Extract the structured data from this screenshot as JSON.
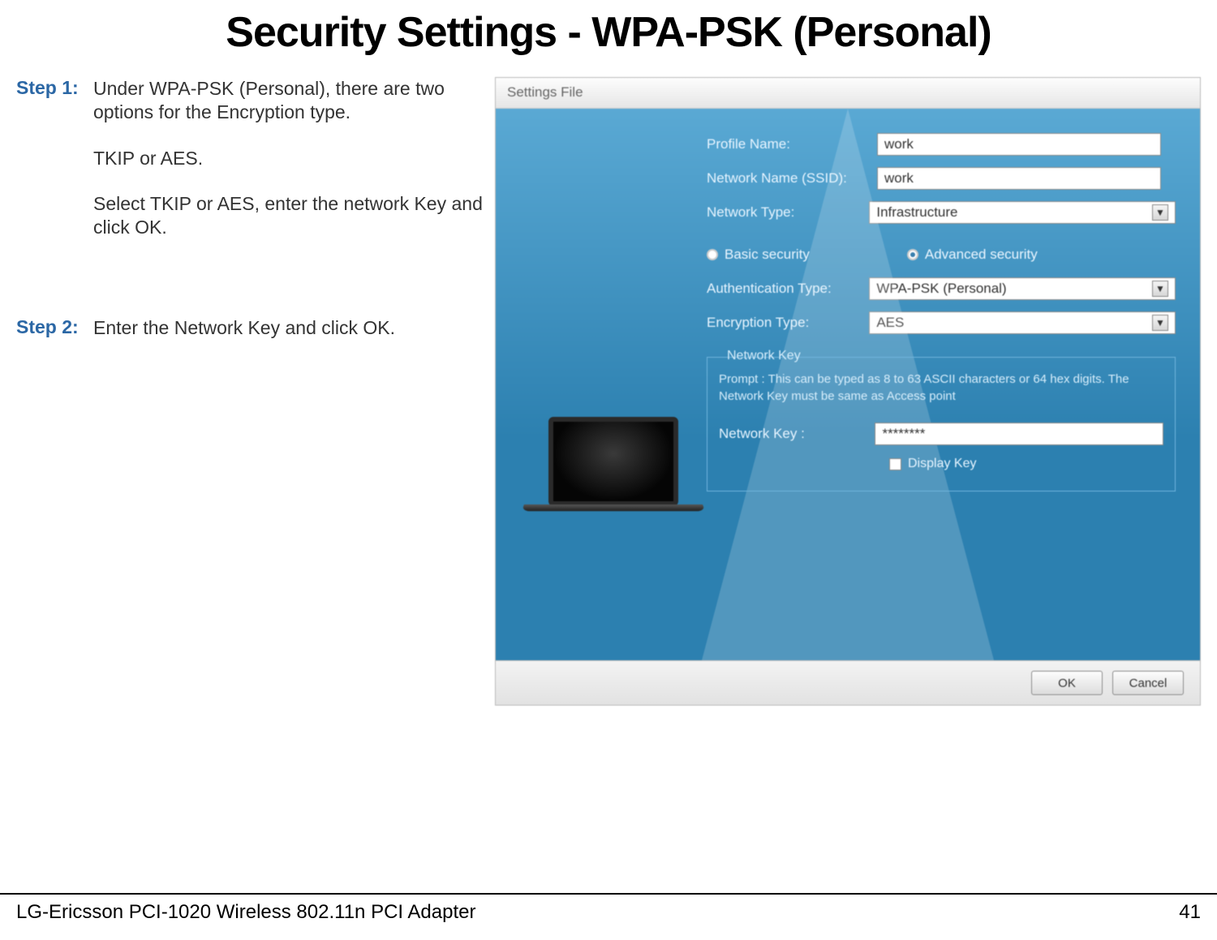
{
  "page_title": "Security Settings - WPA-PSK (Personal)",
  "steps": [
    {
      "label": "Step 1:",
      "paragraphs": [
        "Under WPA-PSK (Personal), there are two options for the Encryption type.",
        "TKIP or AES.",
        "Select TKIP or AES, enter the network Key and click OK."
      ]
    },
    {
      "label": "Step 2:",
      "paragraphs": [
        "Enter the Network Key and click OK."
      ]
    }
  ],
  "dialog": {
    "window_title": "Settings File",
    "fields": {
      "profile_name": {
        "label": "Profile Name:",
        "value": "work"
      },
      "ssid": {
        "label": "Network Name (SSID):",
        "value": "work"
      },
      "network_type": {
        "label": "Network Type:",
        "value": "Infrastructure"
      },
      "auth_type": {
        "label": "Authentication Type:",
        "value": "WPA-PSK (Personal)"
      },
      "enc_type": {
        "label": "Encryption Type:",
        "value": "AES"
      },
      "network_key": {
        "label": "Network Key :",
        "value": "********"
      }
    },
    "security_mode": {
      "basic": "Basic security",
      "advanced": "Advanced security",
      "selected": "advanced"
    },
    "nk_group": {
      "legend": "Network Key",
      "prompt": "Prompt : This can be typed as 8 to 63 ASCII characters or 64 hex digits. The Network Key must be same as Access point",
      "display_key": "Display Key"
    },
    "buttons": {
      "ok": "OK",
      "cancel": "Cancel"
    }
  },
  "footer": {
    "left": "LG-Ericsson PCI-1020 Wireless 802.11n PCI Adapter",
    "right": "41"
  }
}
